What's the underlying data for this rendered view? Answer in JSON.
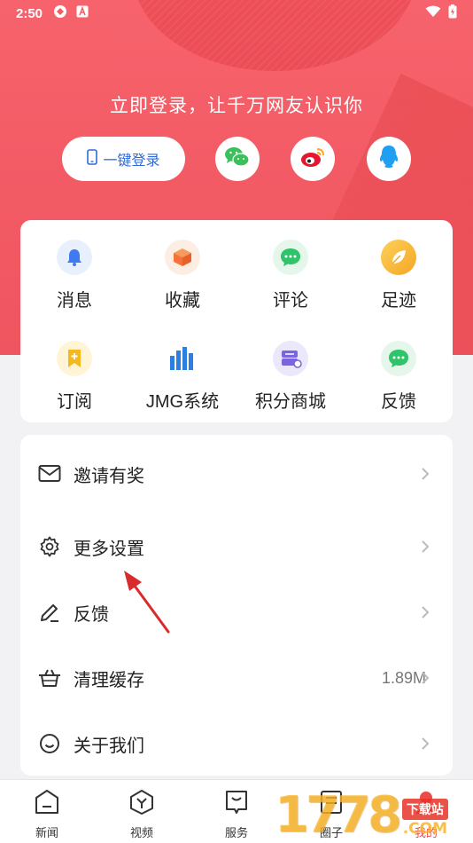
{
  "status_bar": {
    "time": "2:50"
  },
  "login": {
    "prompt": "立即登录，让千万网友认识你",
    "one_click_label": "一键登录"
  },
  "grid": [
    {
      "label": "消息",
      "icon": "bell-icon",
      "bg": "#e8f0fd",
      "color": "#3f7af0"
    },
    {
      "label": "收藏",
      "icon": "box-icon",
      "bg": "#fdeee4",
      "color": "#f5733a"
    },
    {
      "label": "评论",
      "icon": "chat-bubble-icon",
      "bg": "#e4f7ea",
      "color": "#2fc46a"
    },
    {
      "label": "足迹",
      "icon": "leaf-icon",
      "bg": "#fbe9c4",
      "color": "#f5a623"
    },
    {
      "label": "订阅",
      "icon": "bookmark-icon",
      "bg": "#fff4d6",
      "color": "#f5b91e"
    },
    {
      "label": "JMG系统",
      "icon": "bar-chart-icon",
      "bg": "#ffffff",
      "color": "#2b7fe0"
    },
    {
      "label": "积分商城",
      "icon": "points-mall-icon",
      "bg": "#ece8fb",
      "color": "#7a64e0"
    },
    {
      "label": "反馈",
      "icon": "feedback-bubble-icon",
      "bg": "#e4f7ea",
      "color": "#2fc46a"
    }
  ],
  "list": [
    {
      "label": "邀请有奖",
      "icon": "envelope-icon",
      "value": ""
    },
    {
      "label": "更多设置",
      "icon": "gear-icon",
      "value": ""
    },
    {
      "label": "反馈",
      "icon": "pencil-icon",
      "value": ""
    },
    {
      "label": "清理缓存",
      "icon": "basket-icon",
      "value": "1.89M"
    },
    {
      "label": "关于我们",
      "icon": "smiley-icon",
      "value": ""
    }
  ],
  "tabs": [
    {
      "label": "新闻",
      "icon": "news-icon",
      "active": false
    },
    {
      "label": "视频",
      "icon": "video-icon",
      "active": false
    },
    {
      "label": "服务",
      "icon": "service-icon",
      "active": false
    },
    {
      "label": "圈子",
      "icon": "circle-icon",
      "active": false
    },
    {
      "label": "我的",
      "icon": "profile-icon",
      "active": true
    }
  ],
  "watermark": {
    "number": "1778",
    "badge": "下载站",
    "domain": ".COM"
  },
  "colors": {
    "accent": "#f25a64",
    "link_blue": "#2f6bd8",
    "active_tab": "#ef4a4a",
    "annotation_arrow": "#d92b2b"
  }
}
